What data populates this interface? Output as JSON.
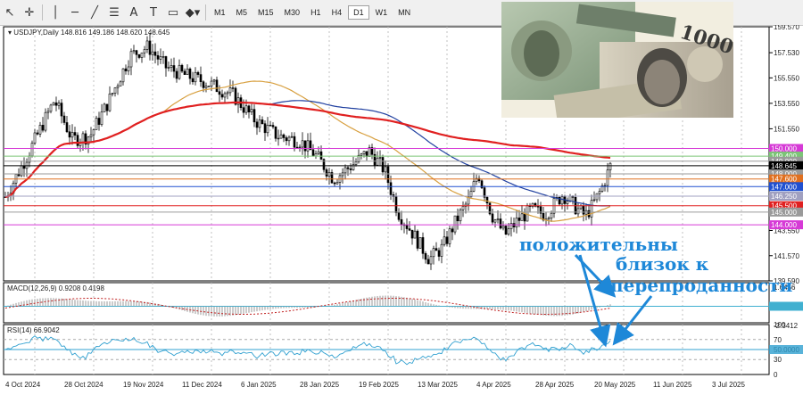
{
  "toolbar": {
    "timeframes": [
      "M1",
      "M5",
      "M15",
      "M30",
      "H1",
      "H4",
      "D1",
      "W1",
      "MN"
    ],
    "active_timeframe": "D1"
  },
  "chart": {
    "header": "USDJPY,Daily  148.816 149.186 148.620 148.645",
    "price_ticks": [
      "159.570",
      "157.530",
      "155.550",
      "153.550",
      "151.550",
      "149.550",
      "147.550",
      "145.550",
      "143.550",
      "141.570",
      "139.590"
    ],
    "levels": [
      {
        "label": "150.000",
        "value": 150.0,
        "color": "#d63ad6"
      },
      {
        "label": "149.400",
        "value": 149.4,
        "color": "#7cc576"
      },
      {
        "label": "149.000",
        "value": 149.0,
        "color": "#9a9a9a"
      },
      {
        "label": "148.645",
        "value": 148.645,
        "color": "#000000"
      },
      {
        "label": "148.000",
        "value": 148.0,
        "color": "#9a9a9a"
      },
      {
        "label": "147.600",
        "value": 147.6,
        "color": "#e07020"
      },
      {
        "label": "147.000",
        "value": 147.0,
        "color": "#2050d0"
      },
      {
        "label": "146.250",
        "value": 146.25,
        "color": "#a0a0c0"
      },
      {
        "label": "145.500",
        "value": 145.5,
        "color": "#e02020"
      },
      {
        "label": "145.000",
        "value": 145.0,
        "color": "#9a9a9a"
      },
      {
        "label": "144.000",
        "value": 144.0,
        "color": "#d63ad6"
      }
    ],
    "date_labels": [
      "4 Oct 2024",
      "28 Oct 2024",
      "19 Nov 2024",
      "11 Dec 2024",
      "6 Jan 2025",
      "28 Jan 2025",
      "19 Feb 2025",
      "13 Mar 2025",
      "4 Apr 2025",
      "28 Apr 2025",
      "20 May 2025",
      "11 Jun 2025",
      "3 Jul 2025"
    ],
    "macd": {
      "header": "MACD(12,26,9) 0.9208 0.4198",
      "ticks": [
        "1.6456",
        "0.0000",
        "-2.3412"
      ]
    },
    "rsi": {
      "header": "RSI(14) 66.9042",
      "ticks": [
        "100",
        "70",
        "50.0000",
        "30",
        "0"
      ]
    },
    "colors": {
      "ma200": "#e02020",
      "ma100": "#2040a0",
      "ma50": "#d8a040",
      "rsi_line": "#30a0d0",
      "macd_level": "#40b0d0"
    }
  },
  "annotation": {
    "line1": "положительны",
    "line2": "близок к",
    "line3": "перепроданности"
  },
  "image": {
    "depicts": "us-dollar-and-japanese-yen-banknotes"
  }
}
